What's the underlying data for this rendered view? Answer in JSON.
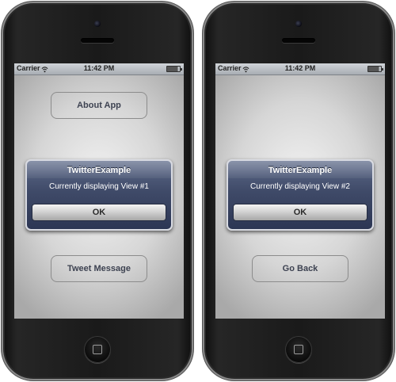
{
  "status_bar": {
    "carrier": "Carrier",
    "time": "11:42 PM"
  },
  "phones": [
    {
      "top_button_label": "About App",
      "alert": {
        "title": "TwitterExample",
        "message": "Currently displaying View #1",
        "ok_label": "OK"
      },
      "bottom_button_label": "Tweet Message"
    },
    {
      "top_button_label": "",
      "alert": {
        "title": "TwitterExample",
        "message": "Currently displaying View #2",
        "ok_label": "OK"
      },
      "bottom_button_label": "Go Back"
    }
  ],
  "colors": {
    "alert_background": "#3f4a68",
    "button_text": "#3d4251",
    "phone_body": "#1a1a1a"
  }
}
